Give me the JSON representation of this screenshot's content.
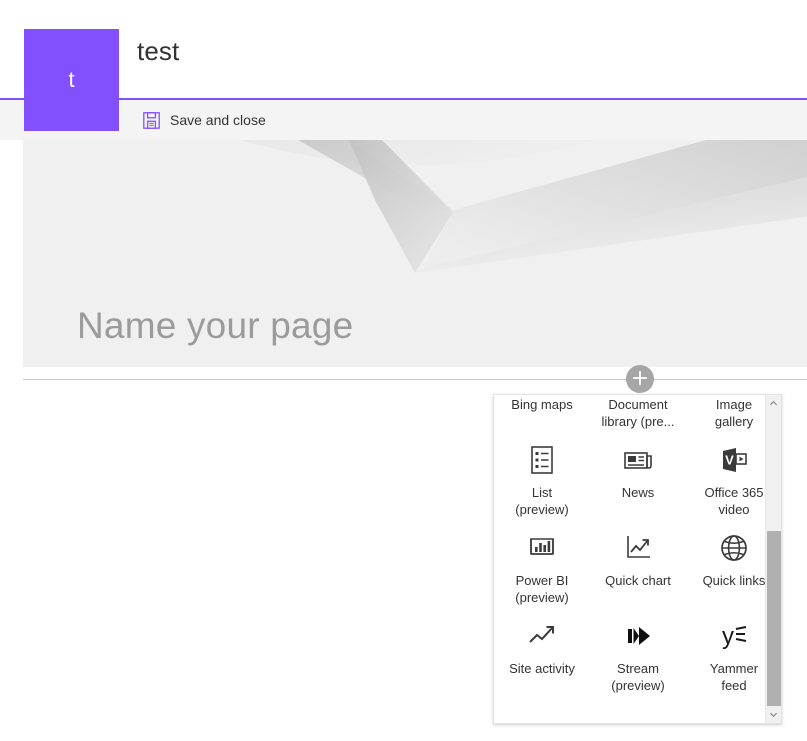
{
  "site": {
    "logo_letter": "t",
    "logo_color": "#8250ff",
    "title": "test"
  },
  "command_bar": {
    "save_and_close_label": "Save and close",
    "save_icon": "save-floppy-icon",
    "save_icon_color": "#8250ff"
  },
  "hero": {
    "page_name_placeholder": "Name your page"
  },
  "canvas": {
    "add_webpart_icon": "plus-circle-icon"
  },
  "webpart_picker": {
    "scroll_up_icon": "chevron-up-icon",
    "scroll_down_icon": "chevron-down-icon",
    "items": [
      {
        "label": "Bing maps",
        "icon": "bing-maps-icon"
      },
      {
        "label": "Document\nlibrary (pre...",
        "icon": "document-library-icon"
      },
      {
        "label": "Image\ngallery",
        "icon": "image-gallery-icon"
      },
      {
        "label": "List\n(preview)",
        "icon": "list-icon"
      },
      {
        "label": "News",
        "icon": "news-icon"
      },
      {
        "label": "Office 365\nvideo",
        "icon": "office-365-video-icon"
      },
      {
        "label": "Power BI\n(preview)",
        "icon": "power-bi-icon"
      },
      {
        "label": "Quick chart",
        "icon": "quick-chart-icon"
      },
      {
        "label": "Quick links",
        "icon": "globe-icon"
      },
      {
        "label": "Site activity",
        "icon": "trending-up-icon"
      },
      {
        "label": "Stream\n(preview)",
        "icon": "stream-play-icon"
      },
      {
        "label": "Yammer\nfeed",
        "icon": "yammer-icon"
      }
    ]
  }
}
